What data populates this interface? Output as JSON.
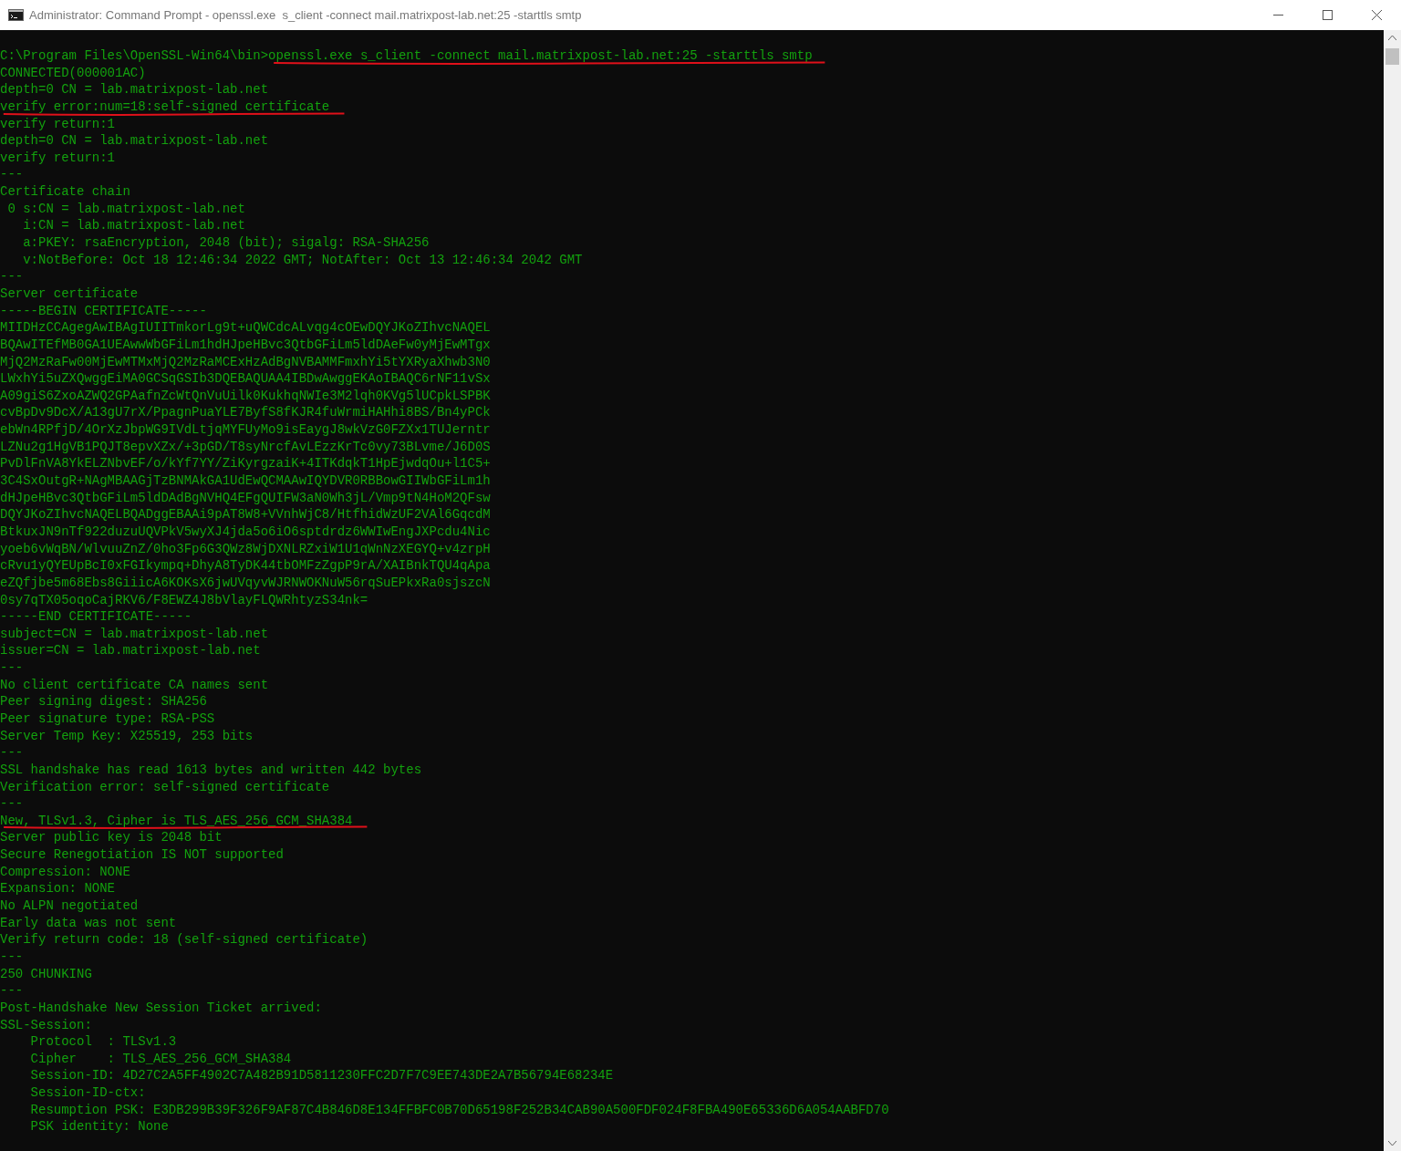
{
  "window": {
    "title": "Administrator: Command Prompt - openssl.exe  s_client -connect mail.matrixpost-lab.net:25 -starttls smtp"
  },
  "terminal": {
    "prompt": "C:\\Program Files\\OpenSSL-Win64\\bin>",
    "command": "openssl.exe s_client -connect mail.matrixpost-lab.net:25 -starttls smtp",
    "command_underlined": true,
    "lines": [
      {
        "text": "CONNECTED(000001AC)",
        "underlined": false
      },
      {
        "text": "depth=0 CN = lab.matrixpost-lab.net",
        "underlined": false
      },
      {
        "text": "verify error:num=18:self-signed certificate",
        "underlined": true
      },
      {
        "text": "verify return:1",
        "underlined": false
      },
      {
        "text": "depth=0 CN = lab.matrixpost-lab.net",
        "underlined": false
      },
      {
        "text": "verify return:1",
        "underlined": false
      },
      {
        "text": "---",
        "underlined": false
      },
      {
        "text": "Certificate chain",
        "underlined": false
      },
      {
        "text": " 0 s:CN = lab.matrixpost-lab.net",
        "underlined": false
      },
      {
        "text": "   i:CN = lab.matrixpost-lab.net",
        "underlined": false
      },
      {
        "text": "   a:PKEY: rsaEncryption, 2048 (bit); sigalg: RSA-SHA256",
        "underlined": false
      },
      {
        "text": "   v:NotBefore: Oct 18 12:46:34 2022 GMT; NotAfter: Oct 13 12:46:34 2042 GMT",
        "underlined": false
      },
      {
        "text": "---",
        "underlined": false
      },
      {
        "text": "Server certificate",
        "underlined": false
      },
      {
        "text": "-----BEGIN CERTIFICATE-----",
        "underlined": false
      },
      {
        "text": "MIIDHzCCAgegAwIBAgIUIITmkorLg9t+uQWCdcALvqg4cOEwDQYJKoZIhvcNAQEL",
        "underlined": false
      },
      {
        "text": "BQAwITEfMB0GA1UEAwwWbGFiLm1hdHJpeHBvc3QtbGFiLm5ldDAeFw0yMjEwMTgx",
        "underlined": false
      },
      {
        "text": "MjQ2MzRaFw00MjEwMTMxMjQ2MzRaMCExHzAdBgNVBAMMFmxhYi5tYXRyaXhwb3N0",
        "underlined": false
      },
      {
        "text": "LWxhYi5uZXQwggEiMA0GCSqGSIb3DQEBAQUAA4IBDwAwggEKAoIBAQC6rNF11vSx",
        "underlined": false
      },
      {
        "text": "A09giS6ZxoAZWQ2GPAafnZcWtQnVuUilk0KukhqNWIe3M2lqh0KVg5lUCpkLSPBK",
        "underlined": false
      },
      {
        "text": "cvBpDv9DcX/A13gU7rX/PpagnPuaYLE7ByfS8fKJR4fuWrmiHAHhi8BS/Bn4yPCk",
        "underlined": false
      },
      {
        "text": "ebWn4RPfjD/4OrXzJbpWG9IVdLtjqMYFUyMo9isEaygJ8wkVzG0FZXx1TUJerntr",
        "underlined": false
      },
      {
        "text": "LZNu2g1HgVB1PQJT8epvXZx/+3pGD/T8syNrcfAvLEzzKrTc0vy73BLvme/J6D0S",
        "underlined": false
      },
      {
        "text": "PvDlFnVA8YkELZNbvEF/o/kYf7YY/ZiKyrgzaiK+4ITKdqkT1HpEjwdqOu+l1C5+",
        "underlined": false
      },
      {
        "text": "3C4SxOutgR+NAgMBAAGjTzBNMAkGA1UdEwQCMAAwIQYDVR0RBBowGIIWbGFiLm1h",
        "underlined": false
      },
      {
        "text": "dHJpeHBvc3QtbGFiLm5ldDAdBgNVHQ4EFgQUIFW3aN0Wh3jL/Vmp9tN4HoM2QFsw",
        "underlined": false
      },
      {
        "text": "DQYJKoZIhvcNAQELBQADggEBAAi9pAT8W8+VVnhWjC8/HtfhidWzUF2VAl6GqcdM",
        "underlined": false
      },
      {
        "text": "BtkuxJN9nTf922duzuUQVPkV5wyXJ4jda5o6iO6sptdrdz6WWIwEngJXPcdu4Nic",
        "underlined": false
      },
      {
        "text": "yoeb6vWqBN/WlvuuZnZ/0ho3Fp6G3QWz8WjDXNLRZxiW1U1qWnNzXEGYQ+v4zrpH",
        "underlined": false
      },
      {
        "text": "cRvu1yQYEUpBcI0xFGIkympq+DhyA8TyDK44tbOMFzZgpP9rA/XAIBnkTQU4qApa",
        "underlined": false
      },
      {
        "text": "eZQfjbe5m68Ebs8GiiicA6KOKsX6jwUVqyvWJRNWOKNuW56rqSuEPkxRa0sjszcN",
        "underlined": false
      },
      {
        "text": "0sy7qTX05oqoCajRKV6/F8EWZ4J8bVlayFLQWRhtyzS34nk=",
        "underlined": false
      },
      {
        "text": "-----END CERTIFICATE-----",
        "underlined": false
      },
      {
        "text": "subject=CN = lab.matrixpost-lab.net",
        "underlined": false
      },
      {
        "text": "issuer=CN = lab.matrixpost-lab.net",
        "underlined": false
      },
      {
        "text": "---",
        "underlined": false
      },
      {
        "text": "No client certificate CA names sent",
        "underlined": false
      },
      {
        "text": "Peer signing digest: SHA256",
        "underlined": false
      },
      {
        "text": "Peer signature type: RSA-PSS",
        "underlined": false
      },
      {
        "text": "Server Temp Key: X25519, 253 bits",
        "underlined": false
      },
      {
        "text": "---",
        "underlined": false
      },
      {
        "text": "SSL handshake has read 1613 bytes and written 442 bytes",
        "underlined": false
      },
      {
        "text": "Verification error: self-signed certificate",
        "underlined": false
      },
      {
        "text": "---",
        "underlined": false
      },
      {
        "text": "New, TLSv1.3, Cipher is TLS_AES_256_GCM_SHA384",
        "underlined": true
      },
      {
        "text": "Server public key is 2048 bit",
        "underlined": false
      },
      {
        "text": "Secure Renegotiation IS NOT supported",
        "underlined": false
      },
      {
        "text": "Compression: NONE",
        "underlined": false
      },
      {
        "text": "Expansion: NONE",
        "underlined": false
      },
      {
        "text": "No ALPN negotiated",
        "underlined": false
      },
      {
        "text": "Early data was not sent",
        "underlined": false
      },
      {
        "text": "Verify return code: 18 (self-signed certificate)",
        "underlined": false
      },
      {
        "text": "---",
        "underlined": false
      },
      {
        "text": "250 CHUNKING",
        "underlined": false
      },
      {
        "text": "---",
        "underlined": false
      },
      {
        "text": "Post-Handshake New Session Ticket arrived:",
        "underlined": false
      },
      {
        "text": "SSL-Session:",
        "underlined": false
      },
      {
        "text": "    Protocol  : TLSv1.3",
        "underlined": false
      },
      {
        "text": "    Cipher    : TLS_AES_256_GCM_SHA384",
        "underlined": false
      },
      {
        "text": "    Session-ID: 4D27C2A5FF4902C7A482B91D5811230FFC2D7F7C9EE743DE2A7B56794E68234E",
        "underlined": false
      },
      {
        "text": "    Session-ID-ctx:",
        "underlined": false
      },
      {
        "text": "    Resumption PSK: E3DB299B39F326F9AF87C4B846D8E134FFBFC0B70D65198F252B34CAB90A500FDF024F8FBA490E65336D6A054AABFD70",
        "underlined": false
      },
      {
        "text": "    PSK identity: None",
        "underlined": false
      }
    ]
  }
}
